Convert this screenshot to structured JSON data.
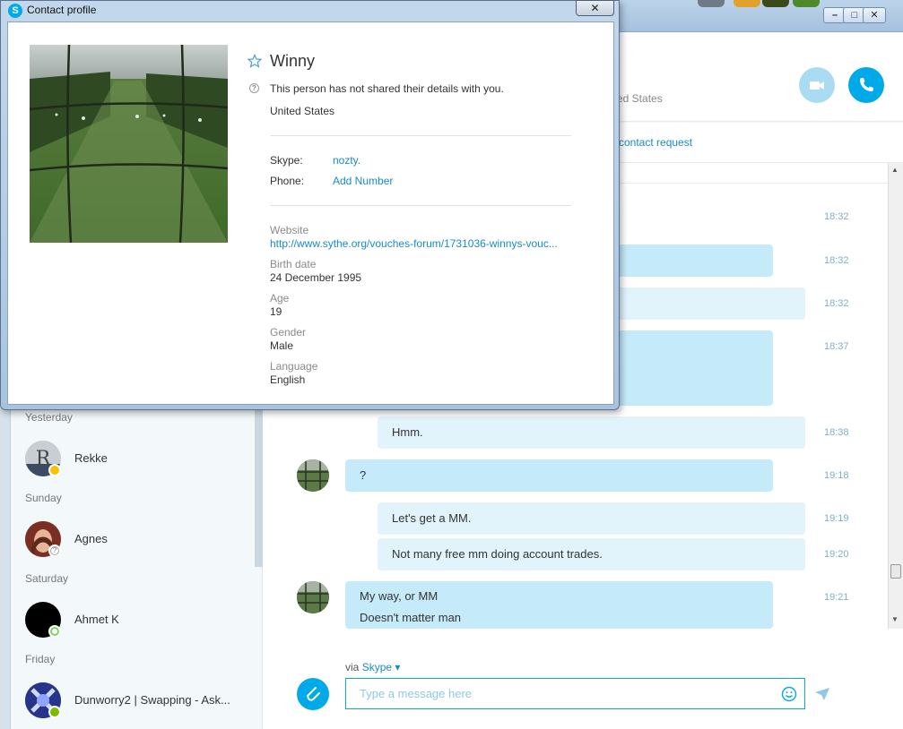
{
  "profile_window": {
    "title": "Contact profile",
    "close_label": "✕",
    "name": "Winny",
    "privacy_text": "This person has not shared their details with you.",
    "country": "United States",
    "skype_label": "Skype:",
    "skype_value": "nozty.",
    "phone_label": "Phone:",
    "phone_action": "Add Number",
    "website_label": "Website",
    "website_value": "http://www.sythe.org/vouches-forum/1731036-winnys-vouc...",
    "birth_label": "Birth date",
    "birth_value": "24 December 1995",
    "age_label": "Age",
    "age_value": "19",
    "gender_label": "Gender",
    "gender_value": "Male",
    "language_label": "Language",
    "language_value": "English"
  },
  "chat_header": {
    "location_partial": "ed States",
    "contact_request_partial": "contact request"
  },
  "messages": [
    {
      "text": "",
      "time": "18:32",
      "side": "none"
    },
    {
      "text": "",
      "time": "18:32",
      "side": "in"
    },
    {
      "text": "",
      "time": "18:32",
      "side": "out"
    },
    {
      "text": "",
      "time": "18:37",
      "side": "in"
    },
    {
      "text": "Hmm.",
      "time": "18:38",
      "side": "out"
    },
    {
      "text": "?",
      "time": "19:18",
      "side": "in"
    },
    {
      "text": "Let's get a MM.",
      "time": "19:19",
      "side": "out"
    },
    {
      "text": "Not many free mm doing account trades.",
      "time": "19:20",
      "side": "out"
    },
    {
      "text": "My way, or MM",
      "text2": "Doesn't matter man",
      "time": "19:21",
      "side": "in"
    }
  ],
  "compose": {
    "via_prefix": "via",
    "via_service": "Skype ▾",
    "placeholder": "Type a message here"
  },
  "recent": {
    "groups": [
      {
        "day": "Yesterday",
        "contact": "Rekke",
        "status": "away"
      },
      {
        "day": "Sunday",
        "contact": "Agnes",
        "status": "unknown"
      },
      {
        "day": "Saturday",
        "contact": "Ahmet K",
        "status": "offline"
      },
      {
        "day": "Friday",
        "contact": "Dunworry2 | Swapping   - Ask...",
        "status": "online"
      }
    ]
  },
  "colors": {
    "accent": "#00a9e8",
    "link": "#1a8ac6",
    "bubble_in": "#c5ebfa",
    "bubble_out": "#e1f4fc",
    "time": "#7fb0c8"
  },
  "icons": [
    "star-icon",
    "help-circle-icon",
    "video-camera-icon",
    "phone-icon",
    "paperclip-icon",
    "emoji-icon",
    "send-icon",
    "skype-logo-icon"
  ]
}
